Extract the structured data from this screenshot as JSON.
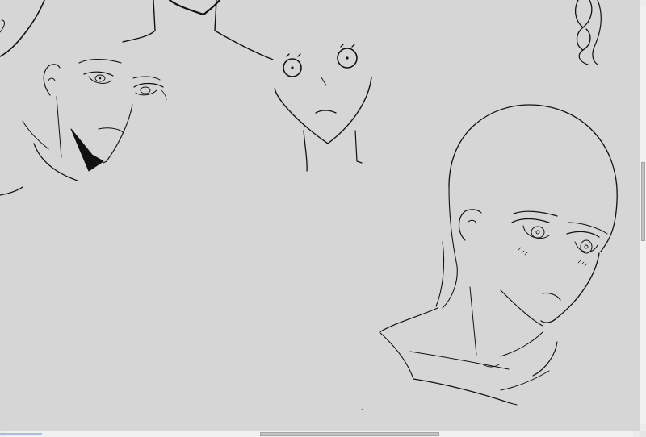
{
  "app": {
    "canvas_background": "#d6d6d6",
    "stroke_color": "#111111"
  },
  "canvas": {
    "sketches": [
      "head-sketch-left",
      "head-sketch-center",
      "head-sketch-bald",
      "hair-braid-sketch"
    ]
  },
  "scrollbars": {
    "vertical": {
      "position": 0.4
    },
    "horizontal": {
      "position": 0.42
    }
  }
}
